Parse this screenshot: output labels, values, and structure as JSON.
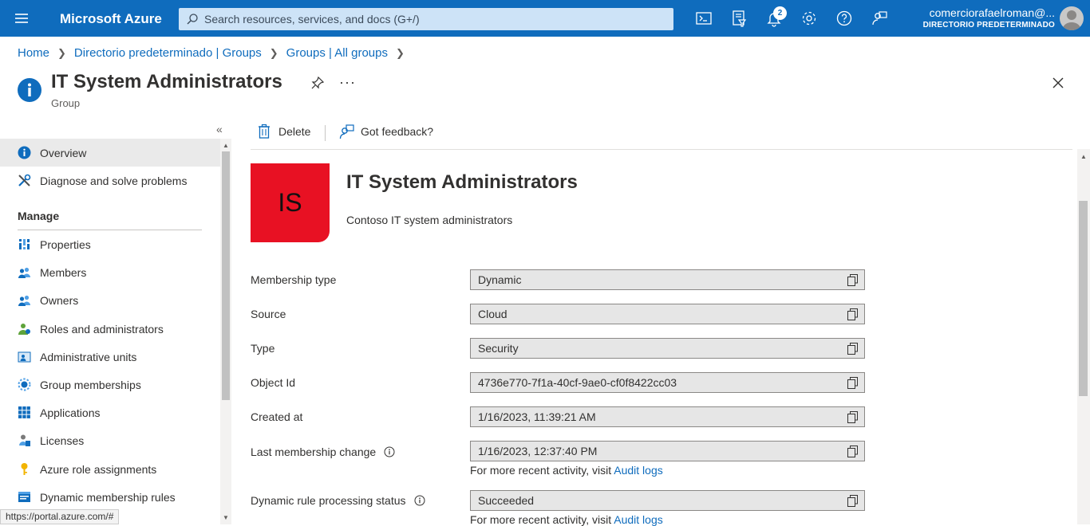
{
  "topbar": {
    "brand": "Microsoft Azure",
    "search_placeholder": "Search resources, services, and docs (G+/)",
    "notification_count": "2",
    "user_name": "comerciorafaelroman@...",
    "user_directory": "DIRECTORIO PREDETERMINADO",
    "icons": [
      "cloud-shell-icon",
      "directory-filter-icon",
      "notifications-icon",
      "settings-icon",
      "help-icon",
      "feedback-icon"
    ]
  },
  "breadcrumb": [
    "Home",
    "Directorio predeterminado | Groups",
    "Groups | All groups"
  ],
  "header": {
    "title": "IT System Administrators",
    "subtitle": "Group",
    "more": "···"
  },
  "sidebar": {
    "collapse_label": "«",
    "items_top": [
      {
        "label": "Overview",
        "icon": "info-icon",
        "active": true
      },
      {
        "label": "Diagnose and solve problems",
        "icon": "wrench-icon",
        "active": false
      }
    ],
    "section_manage": "Manage",
    "items_manage": [
      {
        "label": "Properties",
        "icon": "properties-icon"
      },
      {
        "label": "Members",
        "icon": "members-icon"
      },
      {
        "label": "Owners",
        "icon": "owners-icon"
      },
      {
        "label": "Roles and administrators",
        "icon": "roles-icon"
      },
      {
        "label": "Administrative units",
        "icon": "admin-units-icon"
      },
      {
        "label": "Group memberships",
        "icon": "group-memberships-icon"
      },
      {
        "label": "Applications",
        "icon": "applications-icon"
      },
      {
        "label": "Licenses",
        "icon": "licenses-icon"
      },
      {
        "label": "Azure role assignments",
        "icon": "key-icon"
      },
      {
        "label": "Dynamic membership rules",
        "icon": "dynamic-rules-icon"
      }
    ]
  },
  "commands": {
    "delete": "Delete",
    "feedback": "Got feedback?"
  },
  "group": {
    "initials": "IS",
    "tile_color": "#e81123",
    "name": "IT System Administrators",
    "description": "Contoso IT system administrators"
  },
  "properties": [
    {
      "label": "Membership type",
      "value": "Dynamic"
    },
    {
      "label": "Source",
      "value": "Cloud"
    },
    {
      "label": "Type",
      "value": "Security"
    },
    {
      "label": "Object Id",
      "value": "4736e770-7f1a-40cf-9ae0-cf0f8422cc03"
    },
    {
      "label": "Created at",
      "value": "1/16/2023, 11:39:21 AM"
    },
    {
      "label": "Last membership change",
      "value": "1/16/2023, 12:37:40 PM"
    },
    {
      "label": "Dynamic rule processing status",
      "value": "Succeeded"
    }
  ],
  "notes": {
    "prefix": "For more recent activity, visit",
    "link": "Audit logs"
  },
  "statusbar": "https://portal.azure.com/#",
  "colors": {
    "accent": "#0f6cbd",
    "topbar": "#0f6cbd"
  }
}
